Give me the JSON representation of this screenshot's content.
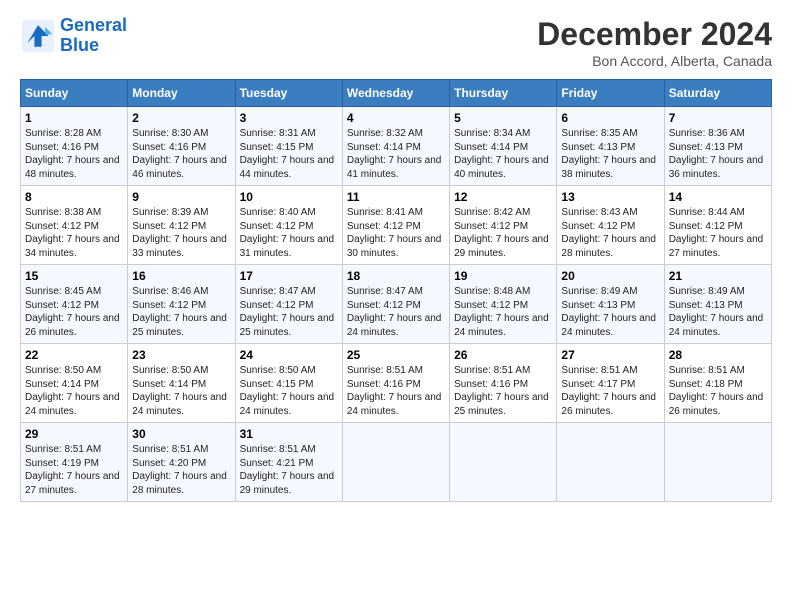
{
  "header": {
    "logo_line1": "General",
    "logo_line2": "Blue",
    "title": "December 2024",
    "location": "Bon Accord, Alberta, Canada"
  },
  "weekdays": [
    "Sunday",
    "Monday",
    "Tuesday",
    "Wednesday",
    "Thursday",
    "Friday",
    "Saturday"
  ],
  "weeks": [
    [
      {
        "day": "1",
        "sr": "8:28 AM",
        "ss": "4:16 PM",
        "dl": "7 hours and 48 minutes."
      },
      {
        "day": "2",
        "sr": "8:30 AM",
        "ss": "4:16 PM",
        "dl": "7 hours and 46 minutes."
      },
      {
        "day": "3",
        "sr": "8:31 AM",
        "ss": "4:15 PM",
        "dl": "7 hours and 44 minutes."
      },
      {
        "day": "4",
        "sr": "8:32 AM",
        "ss": "4:14 PM",
        "dl": "7 hours and 41 minutes."
      },
      {
        "day": "5",
        "sr": "8:34 AM",
        "ss": "4:14 PM",
        "dl": "7 hours and 40 minutes."
      },
      {
        "day": "6",
        "sr": "8:35 AM",
        "ss": "4:13 PM",
        "dl": "7 hours and 38 minutes."
      },
      {
        "day": "7",
        "sr": "8:36 AM",
        "ss": "4:13 PM",
        "dl": "7 hours and 36 minutes."
      }
    ],
    [
      {
        "day": "8",
        "sr": "8:38 AM",
        "ss": "4:12 PM",
        "dl": "7 hours and 34 minutes."
      },
      {
        "day": "9",
        "sr": "8:39 AM",
        "ss": "4:12 PM",
        "dl": "7 hours and 33 minutes."
      },
      {
        "day": "10",
        "sr": "8:40 AM",
        "ss": "4:12 PM",
        "dl": "7 hours and 31 minutes."
      },
      {
        "day": "11",
        "sr": "8:41 AM",
        "ss": "4:12 PM",
        "dl": "7 hours and 30 minutes."
      },
      {
        "day": "12",
        "sr": "8:42 AM",
        "ss": "4:12 PM",
        "dl": "7 hours and 29 minutes."
      },
      {
        "day": "13",
        "sr": "8:43 AM",
        "ss": "4:12 PM",
        "dl": "7 hours and 28 minutes."
      },
      {
        "day": "14",
        "sr": "8:44 AM",
        "ss": "4:12 PM",
        "dl": "7 hours and 27 minutes."
      }
    ],
    [
      {
        "day": "15",
        "sr": "8:45 AM",
        "ss": "4:12 PM",
        "dl": "7 hours and 26 minutes."
      },
      {
        "day": "16",
        "sr": "8:46 AM",
        "ss": "4:12 PM",
        "dl": "7 hours and 25 minutes."
      },
      {
        "day": "17",
        "sr": "8:47 AM",
        "ss": "4:12 PM",
        "dl": "7 hours and 25 minutes."
      },
      {
        "day": "18",
        "sr": "8:47 AM",
        "ss": "4:12 PM",
        "dl": "7 hours and 24 minutes."
      },
      {
        "day": "19",
        "sr": "8:48 AM",
        "ss": "4:12 PM",
        "dl": "7 hours and 24 minutes."
      },
      {
        "day": "20",
        "sr": "8:49 AM",
        "ss": "4:13 PM",
        "dl": "7 hours and 24 minutes."
      },
      {
        "day": "21",
        "sr": "8:49 AM",
        "ss": "4:13 PM",
        "dl": "7 hours and 24 minutes."
      }
    ],
    [
      {
        "day": "22",
        "sr": "8:50 AM",
        "ss": "4:14 PM",
        "dl": "7 hours and 24 minutes."
      },
      {
        "day": "23",
        "sr": "8:50 AM",
        "ss": "4:14 PM",
        "dl": "7 hours and 24 minutes."
      },
      {
        "day": "24",
        "sr": "8:50 AM",
        "ss": "4:15 PM",
        "dl": "7 hours and 24 minutes."
      },
      {
        "day": "25",
        "sr": "8:51 AM",
        "ss": "4:16 PM",
        "dl": "7 hours and 24 minutes."
      },
      {
        "day": "26",
        "sr": "8:51 AM",
        "ss": "4:16 PM",
        "dl": "7 hours and 25 minutes."
      },
      {
        "day": "27",
        "sr": "8:51 AM",
        "ss": "4:17 PM",
        "dl": "7 hours and 26 minutes."
      },
      {
        "day": "28",
        "sr": "8:51 AM",
        "ss": "4:18 PM",
        "dl": "7 hours and 26 minutes."
      }
    ],
    [
      {
        "day": "29",
        "sr": "8:51 AM",
        "ss": "4:19 PM",
        "dl": "7 hours and 27 minutes."
      },
      {
        "day": "30",
        "sr": "8:51 AM",
        "ss": "4:20 PM",
        "dl": "7 hours and 28 minutes."
      },
      {
        "day": "31",
        "sr": "8:51 AM",
        "ss": "4:21 PM",
        "dl": "7 hours and 29 minutes."
      },
      {
        "day": "",
        "sr": "",
        "ss": "",
        "dl": ""
      },
      {
        "day": "",
        "sr": "",
        "ss": "",
        "dl": ""
      },
      {
        "day": "",
        "sr": "",
        "ss": "",
        "dl": ""
      },
      {
        "day": "",
        "sr": "",
        "ss": "",
        "dl": ""
      }
    ]
  ],
  "labels": {
    "sunrise": "Sunrise:",
    "sunset": "Sunset:",
    "daylight": "Daylight:"
  }
}
